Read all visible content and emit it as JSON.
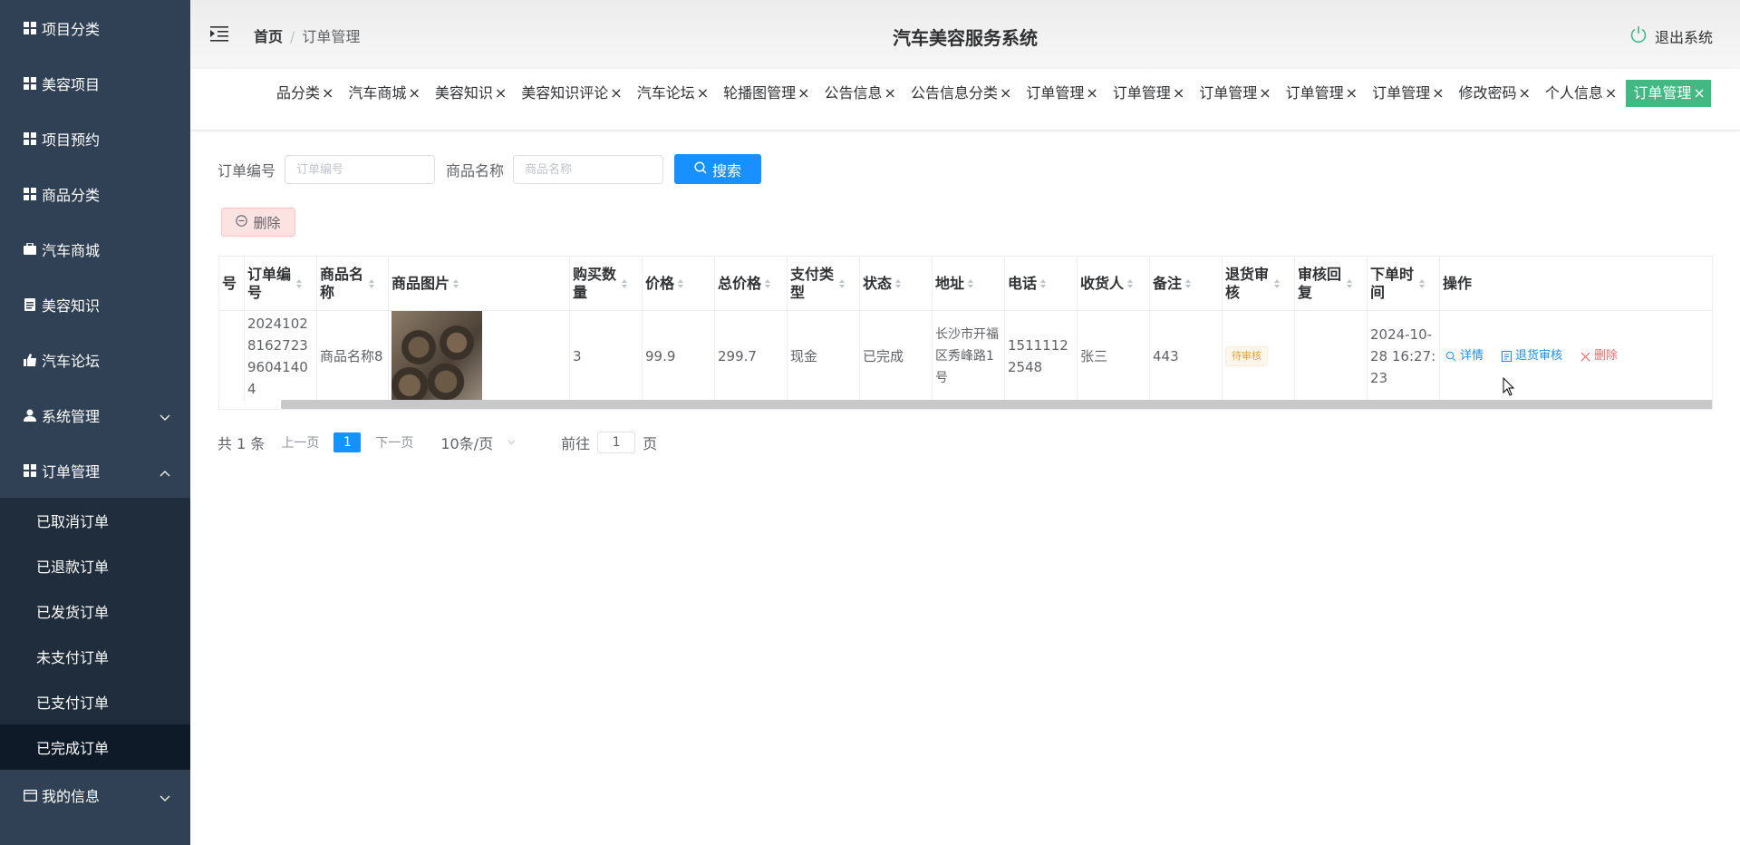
{
  "sidebar": {
    "items": [
      {
        "label": "项目分类",
        "icon": "grid-icon"
      },
      {
        "label": "美容项目",
        "icon": "grid-icon"
      },
      {
        "label": "项目预约",
        "icon": "grid-icon"
      },
      {
        "label": "商品分类",
        "icon": "grid-icon"
      },
      {
        "label": "汽车商城",
        "icon": "briefcase-icon"
      },
      {
        "label": "美容知识",
        "icon": "document-icon"
      },
      {
        "label": "汽车论坛",
        "icon": "thumbs-up-icon"
      },
      {
        "label": "系统管理",
        "icon": "user-icon"
      },
      {
        "label": "订单管理",
        "icon": "grid-icon"
      }
    ],
    "order_submenu": [
      "已取消订单",
      "已退款订单",
      "已发货订单",
      "未支付订单",
      "已支付订单",
      "已完成订单"
    ],
    "last_item": {
      "label": "我的信息",
      "icon": "card-icon"
    }
  },
  "header": {
    "breadcrumb_home": "首页",
    "breadcrumb_separator": "/",
    "breadcrumb_current": "订单管理",
    "title": "汽车美容服务系统",
    "logout": "退出系统"
  },
  "tags": [
    "品分类",
    "汽车商城",
    "美容知识",
    "美容知识评论",
    "汽车论坛",
    "轮播图管理",
    "公告信息",
    "公告信息分类",
    "订单管理",
    "订单管理",
    "订单管理",
    "订单管理",
    "订单管理",
    "修改密码",
    "个人信息",
    "订单管理"
  ],
  "tag_close": "×",
  "search": {
    "order_no_label": "订单编号",
    "order_no_placeholder": "订单编号",
    "product_name_label": "商品名称",
    "product_name_placeholder": "商品名称",
    "button": "搜索"
  },
  "delete_button": "删除",
  "table": {
    "columns": [
      "号",
      "订单编号",
      "商品名称",
      "商品图片",
      "购买数量",
      "价格",
      "总价格",
      "支付类型",
      "状态",
      "地址",
      "电话",
      "收货人",
      "备注",
      "退货审核",
      "审核回复",
      "下单时间",
      "操作"
    ],
    "row": {
      "order_no": "2024102816272396041404",
      "product_name": "商品名称8",
      "quantity": "3",
      "price": "99.9",
      "total": "299.7",
      "pay_type": "现金",
      "status": "已完成",
      "address": "长沙市开福区秀峰路1号",
      "phone": "15111122548",
      "receiver": "张三",
      "remark": "443",
      "return_review": "待审核",
      "review_reply": "",
      "order_time": "2024-10-28 16:27:23"
    },
    "actions": {
      "detail": "详情",
      "return_review": "退货审核",
      "delete": "删除"
    }
  },
  "pagination": {
    "total": "共 1 条",
    "prev": "上一页",
    "page": "1",
    "next": "下一页",
    "page_size": "10条/页",
    "goto_prefix": "前往",
    "goto_value": "1",
    "goto_suffix": "页"
  },
  "colors": {
    "sidebar_bg": "#304156",
    "submenu_bg": "#1f2d3d",
    "active_tag": "#42b983",
    "primary": "#1890ff",
    "danger": "#f56c6c"
  }
}
